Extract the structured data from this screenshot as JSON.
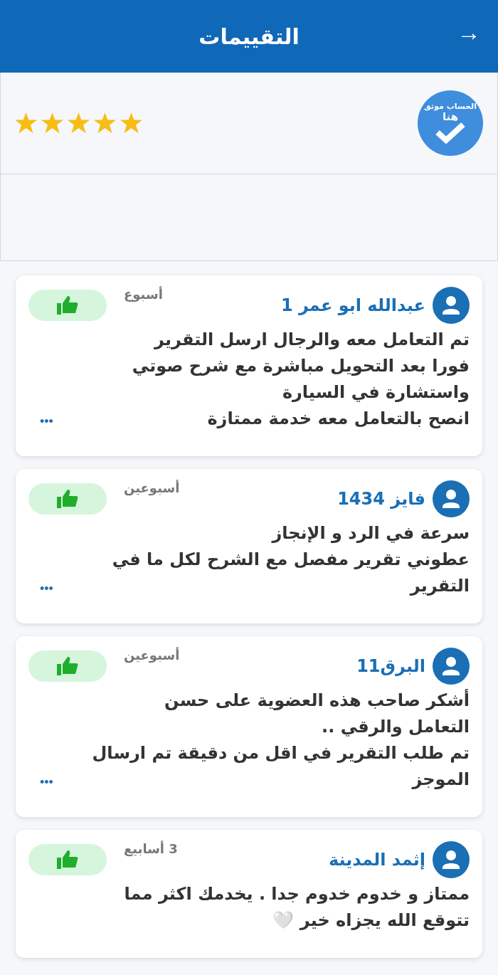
{
  "header": {
    "title": "التقييمات",
    "back": "→"
  },
  "profile": {
    "verified_badge": [
      "الحساب موثق",
      "هنا"
    ],
    "stars": 5
  },
  "reviews": [
    {
      "name": "عبدالله ابو عمر 1",
      "time": "أسبوع",
      "lines": [
        "تم التعامل معه والرجال ارسل التقرير",
        "فورا بعد التحويل مباشرة مع شرح صوتي",
        "واستشارة في السيارة",
        "انصح بالتعامل معه خدمة ممتازة"
      ],
      "more": "•••"
    },
    {
      "name": "فايز 1434",
      "time": "أسبوعين",
      "lines": [
        "سرعة في الرد و الإنجاز",
        "عطوني تقرير مفصل مع الشرح لكل ما في",
        "التقرير"
      ],
      "more": "•••"
    },
    {
      "name": "البرق11",
      "time": "أسبوعين",
      "lines": [
        "أشكر صاحب هذه العضوية على حسن",
        "التعامل والرقي ..",
        "تم طلب التقرير في اقل من دقيقة تم ارسال",
        "الموجز"
      ],
      "more": "•••"
    },
    {
      "name": "إثمد المدينة",
      "time": "3 أسابيع",
      "lines": [
        "ممتاز و خدوم خدوم جدا . يخدمك اكثر مما",
        "تتوقع الله يجزاه خير 🤍"
      ]
    }
  ]
}
